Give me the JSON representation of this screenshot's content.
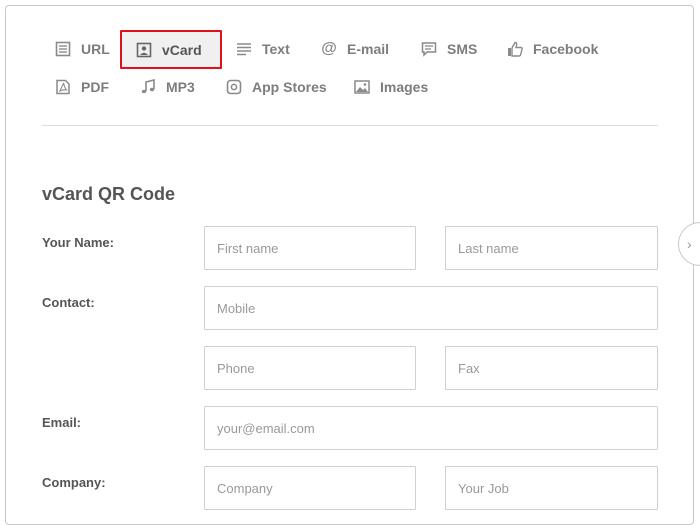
{
  "tabs": [
    {
      "id": "url",
      "label": "URL",
      "icon": "document-lines-icon"
    },
    {
      "id": "vcard",
      "label": "vCard",
      "icon": "contact-card-icon",
      "active": true
    },
    {
      "id": "text",
      "label": "Text",
      "icon": "text-lines-icon"
    },
    {
      "id": "email",
      "label": "E-mail",
      "icon": "at-sign-icon"
    },
    {
      "id": "sms",
      "label": "SMS",
      "icon": "message-icon"
    },
    {
      "id": "facebook",
      "label": "Facebook",
      "icon": "thumbs-up-icon"
    },
    {
      "id": "pdf",
      "label": "PDF",
      "icon": "pdf-icon"
    },
    {
      "id": "mp3",
      "label": "MP3",
      "icon": "music-note-icon"
    },
    {
      "id": "appstores",
      "label": "App Stores",
      "icon": "app-icon"
    },
    {
      "id": "images",
      "label": "Images",
      "icon": "image-icon"
    }
  ],
  "form": {
    "title": "vCard QR Code",
    "labels": {
      "name": "Your Name:",
      "contact": "Contact:",
      "email": "Email:",
      "company": "Company:"
    },
    "placeholders": {
      "first_name": "First name",
      "last_name": "Last name",
      "mobile": "Mobile",
      "phone": "Phone",
      "fax": "Fax",
      "email": "your@email.com",
      "company": "Company",
      "job": "Your Job"
    }
  },
  "colors": {
    "active_tab_outline": "#e0101a",
    "active_tab_bg": "#f0f0f0",
    "tab_text": "#7d7d7d"
  }
}
